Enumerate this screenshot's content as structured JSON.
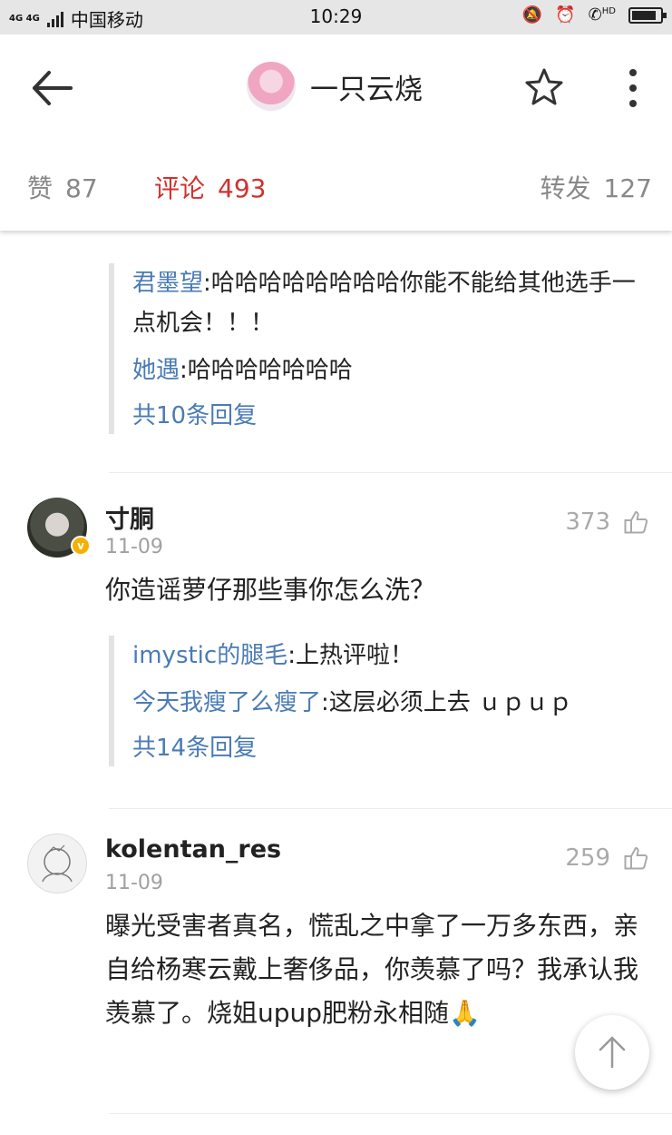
{
  "status_bar": {
    "network": "4G 4G",
    "carrier": "中国移动",
    "time": "10:29",
    "hd": "HD"
  },
  "header": {
    "title": "一只云烧"
  },
  "tabs": {
    "likes_label": "赞",
    "likes_count": "87",
    "comments_label": "评论",
    "comments_count": "493",
    "reposts_label": "转发",
    "reposts_count": "127"
  },
  "colors": {
    "accent_red": "#d0322f",
    "link_blue": "#4a7bb5",
    "verified_gold": "#f5b100"
  },
  "prev_thread": {
    "replies": [
      {
        "user": "君墨望",
        "text": ":哈哈哈哈哈哈哈哈你能不能给其他选手一点机会！！！"
      },
      {
        "user": "她遇",
        "text": ":哈哈哈哈哈哈哈"
      }
    ],
    "more": "共10条回复"
  },
  "comments": [
    {
      "name": "寸胴",
      "date": "11-09",
      "likes": "373",
      "text": "你造谣萝仔那些事你怎么洗？",
      "verified_badge": "v",
      "replies": [
        {
          "user": "imystic的腿毛",
          "text": ":上热评啦！"
        },
        {
          "user": "今天我瘦了么瘦了",
          "text": ":这层必须上去 ｕｐｕｐ"
        }
      ],
      "more": "共14条回复"
    },
    {
      "name": "kolentan_res",
      "date": "11-09",
      "likes": "259",
      "text": "曝光受害者真名，慌乱之中拿了一万多东西，亲自给杨寒云戴上奢侈品，你羡慕了吗？我承认我羡慕了。烧姐upup肥粉永相随🙏"
    }
  ]
}
